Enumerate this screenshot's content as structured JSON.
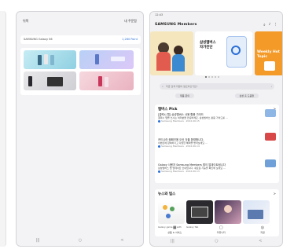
{
  "left_tablet": {
    "header_left": "뒤쪽",
    "header_right": "내 주문함",
    "card_name": "SAMSUNG Galaxy S6",
    "card_price": "1,280 Point",
    "nav": [
      "|||",
      "○",
      "<"
    ]
  },
  "right_tablet": {
    "status_time": "12:43",
    "logo": "SAMSUNG Members",
    "header_icons": [
      "search-icon",
      "bell-icon",
      "more-icon"
    ],
    "banners": {
      "center_text": "삼성멤버스\n자가진단",
      "right_text": "Weekly Hot Topic"
    },
    "search_placeholder": "지금 검색 지원이 필요하신가요?",
    "chips": [
      "제품 문의",
      "삼성 홈 도움말"
    ],
    "section1": {
      "title": "멤버스 Pick",
      "more": ">",
      "posts": [
        {
          "title": "[갤럭시 탭] 삼성멤버스 사용 활용 가이드",
          "body": "갤럭시 탭을 쓰시는 여러분들 안녕하세요. 삼성멤버스 활용 가이드를 ...",
          "meta": "Samsung Members · 2022.06.15"
        },
        {
          "title": "카드나라 캠페인에 오신 것을 환영합니다.",
          "body": "이벤트에 참여하시고 다양한 혜택을 받아보세요 ...",
          "meta": "Samsung Members · 2022.06.14"
        },
        {
          "title": "Galaxy 사용자 Samsung Members 앱이 업데이트됩니다",
          "body": "삼성멤버스 앱 업데이트 안내입니다. 새로운 기능을 확인해 보세요 ...",
          "meta": "Samsung Members · 2022.06.13"
        }
      ]
    },
    "section2": {
      "title": "뉴스와 팁스",
      "more": ">",
      "captions": [
        "Galaxy game up with",
        "Galaxy Tab",
        "",
        ""
      ]
    },
    "bottom_nav": [
      "상품 & 서비스",
      "커뮤니티",
      "지원"
    ],
    "sys_nav": [
      "|||",
      "○",
      "<"
    ]
  }
}
